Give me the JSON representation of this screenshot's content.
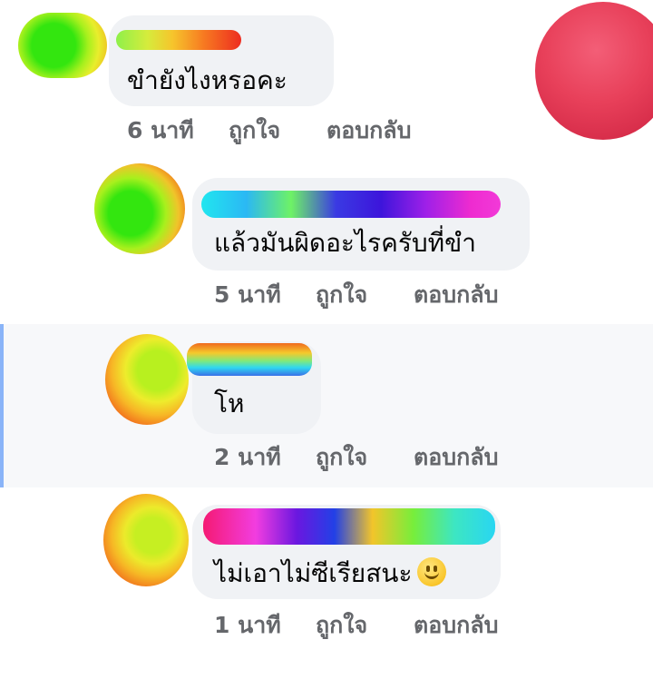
{
  "comments": [
    {
      "text": "ขำยังไงหรอคะ",
      "time": "6 นาที",
      "like": "ถูกใจ",
      "reply": "ตอบกลับ"
    },
    {
      "text": "แล้วมันผิดอะไรครับที่ขำ",
      "time": "5 นาที",
      "like": "ถูกใจ",
      "reply": "ตอบกลับ"
    },
    {
      "text": "โห",
      "time": "2 นาที",
      "like": "ถูกใจ",
      "reply": "ตอบกลับ"
    },
    {
      "text": "ไม่เอาไม่ซีเรียสนะ",
      "emoji": "smiling-face",
      "time": "1 นาที",
      "like": "ถูกใจ",
      "reply": "ตอบกลับ"
    }
  ],
  "colors": {
    "bubble": "#f0f2f5",
    "action_text": "#65676b",
    "highlight_bg": "#f7f8fa",
    "highlight_line": "#8ab4f8",
    "corner_avatar": "#e8405a"
  }
}
